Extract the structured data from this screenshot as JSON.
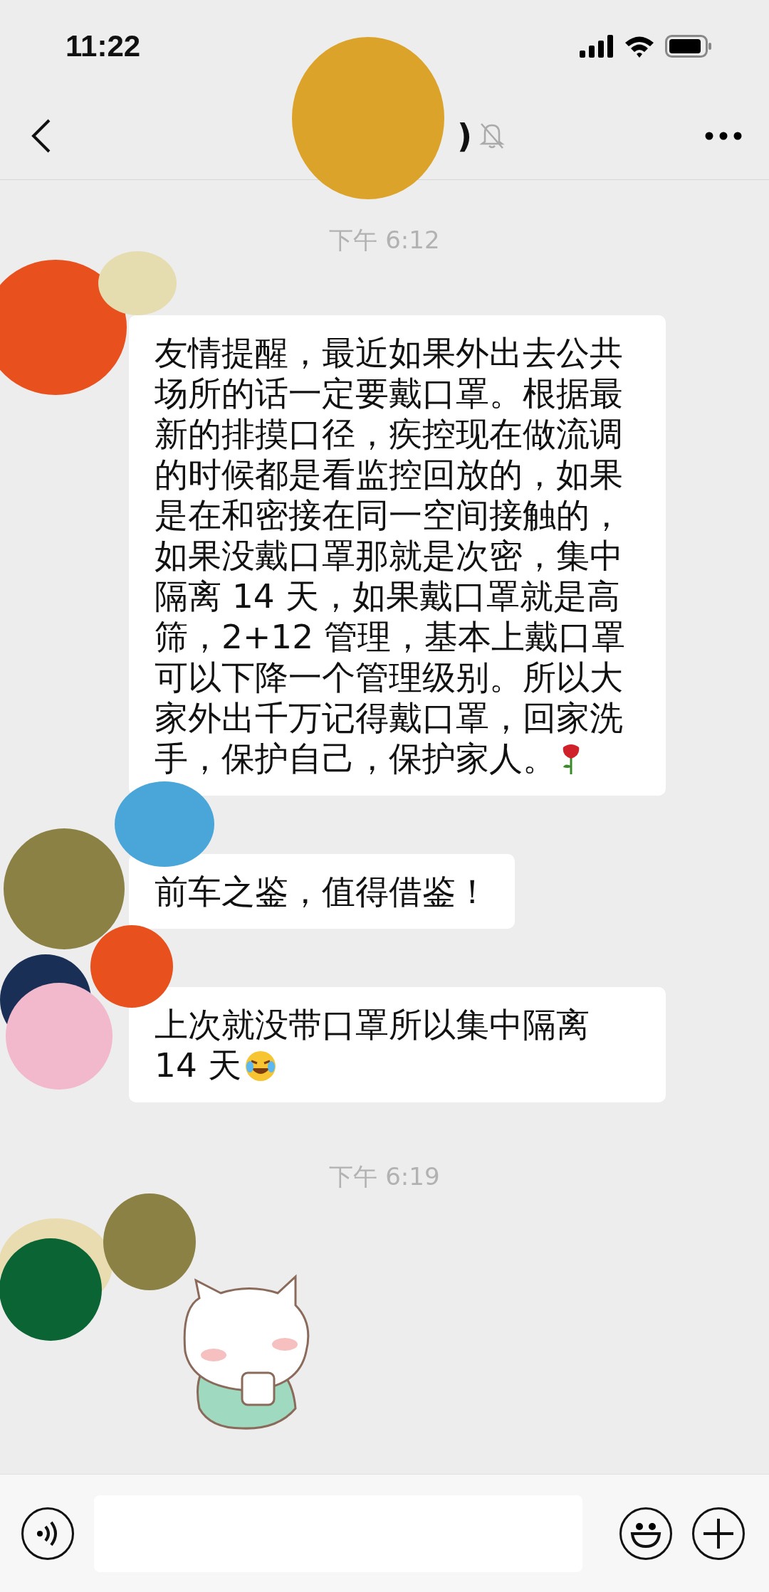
{
  "status_bar": {
    "time": "11:22"
  },
  "nav_bar": {
    "title": ")",
    "muted": true
  },
  "messages": [
    {
      "kind": "time",
      "text": "下午 6:12"
    },
    {
      "kind": "text",
      "text": "友情提醒，最近如果外出去公共场所的话一定要戴口罩。根据最新的排摸口径，疾控现在做流调的时候都是看监控回放的，如果是在和密接在同一空间接触的，如果没戴口罩那就是次密，集中隔离 14 天，如果戴口罩就是高筛，2+12 管理，基本上戴口罩可以下降一个管理级别。所以大家外出千万记得戴口罩，回家洗手，保护自己，保护家人。",
      "emoji": {
        "kind": "rose"
      }
    },
    {
      "kind": "text",
      "text": "前车之鉴，值得借鉴！"
    },
    {
      "kind": "text",
      "text": "上次就没带口罩所以集中隔离 14 天",
      "emoji": {
        "kind": "laugh-cry"
      }
    },
    {
      "kind": "time",
      "text": "下午 6:19"
    },
    {
      "kind": "sticker"
    }
  ]
}
